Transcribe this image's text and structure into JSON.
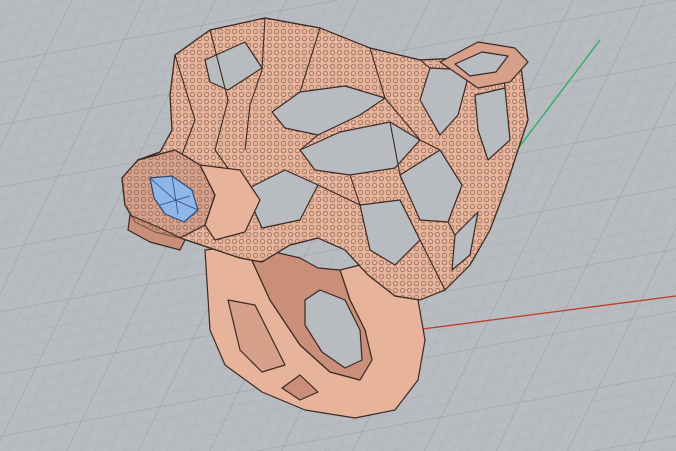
{
  "viewport": {
    "view": "perspective",
    "background_color": "#b8bcc0",
    "grid_minor_color": "#a9adb2",
    "grid_major_color": "#9ea3a8",
    "x_axis_color": "#c0392b",
    "y_axis_color": "#27ae60"
  },
  "model": {
    "name": "panther-head-ring",
    "metal_color": "#e7b39a",
    "metal_shadow_color": "#c98f78",
    "edge_color": "#3a2a24",
    "gem_color": "#8fb6e6",
    "gem_edge_color": "#2d4a7a"
  }
}
